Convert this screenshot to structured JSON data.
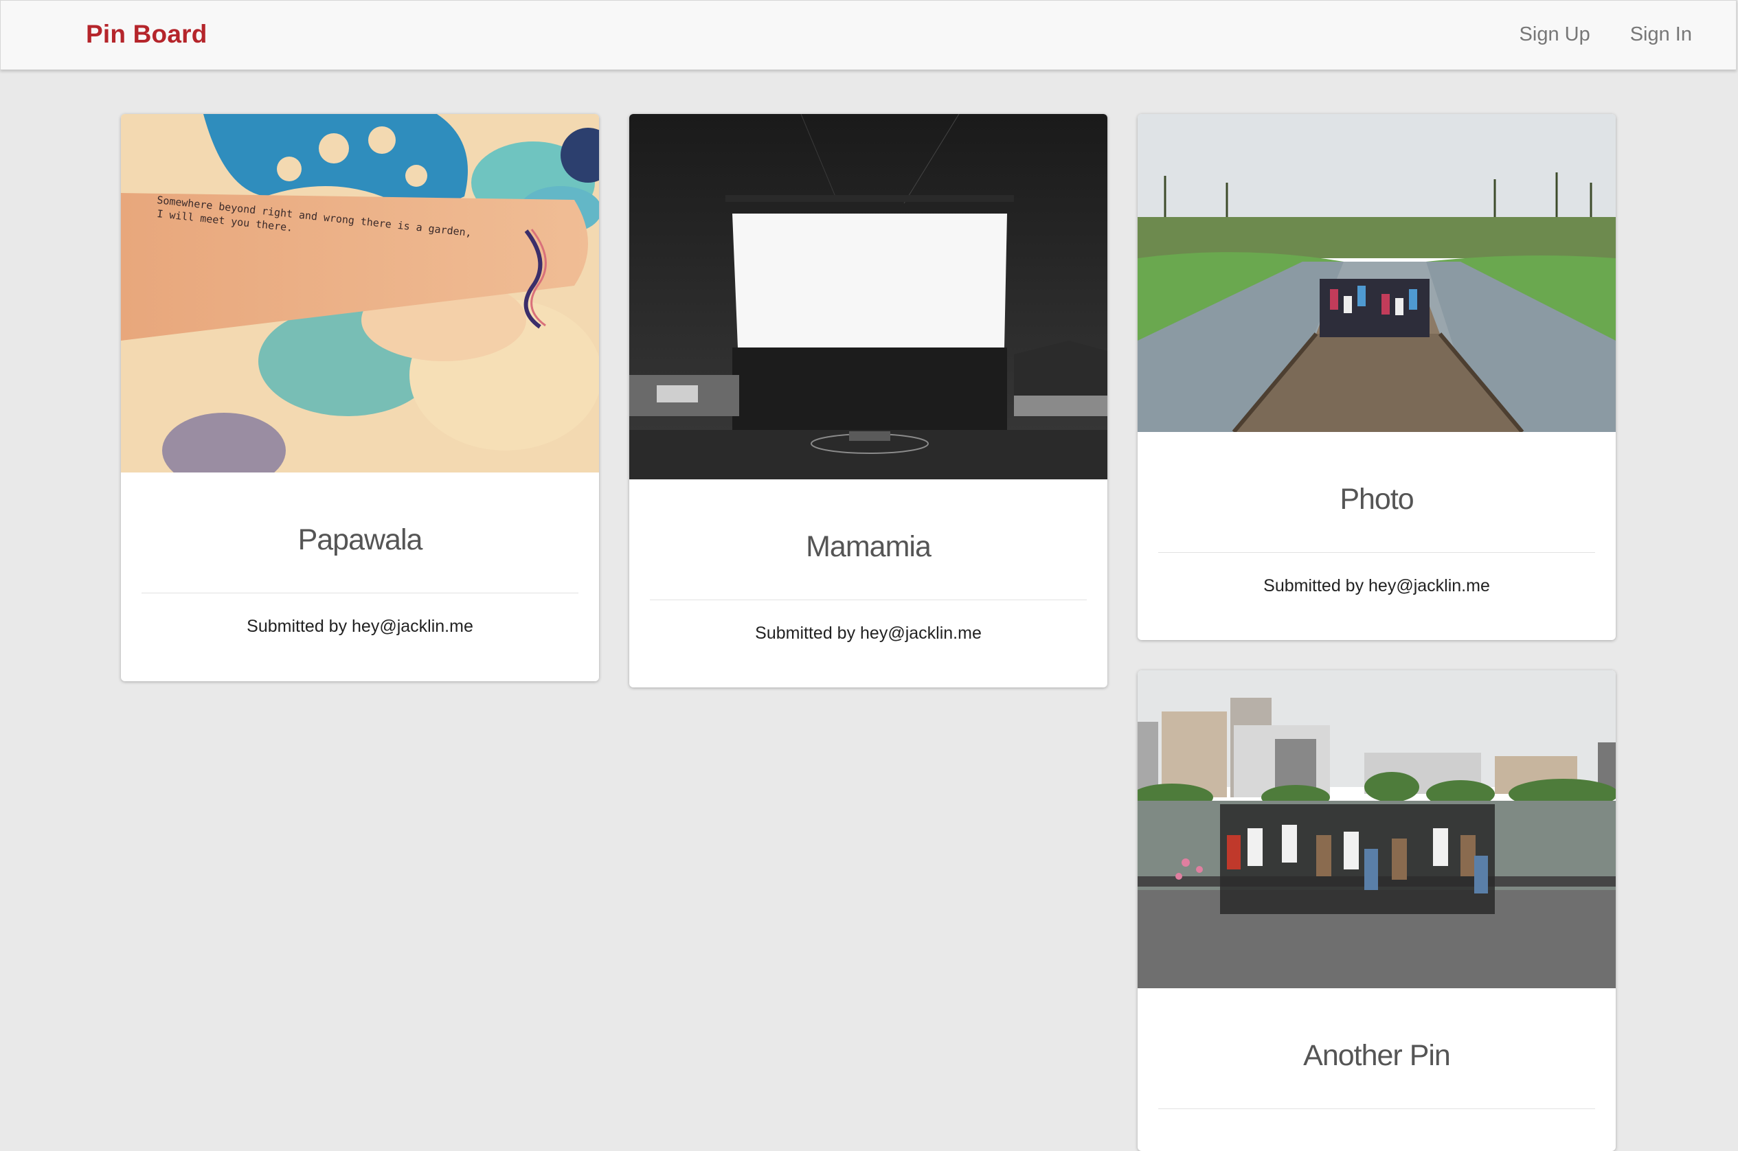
{
  "nav": {
    "brand": "Pin Board",
    "links": [
      "Sign Up",
      "Sign In"
    ]
  },
  "pins": [
    {
      "title": "Papawala",
      "footer": "Submitted by hey@jacklin.me",
      "image_text": [
        "Somewhere beyond right and wrong there is a garden,",
        "I will meet you there."
      ]
    },
    {
      "title": "Mamamia",
      "footer": "Submitted by hey@jacklin.me"
    },
    {
      "title": "Photo",
      "footer": "Submitted by hey@jacklin.me"
    },
    {
      "title": "Another Pin",
      "footer": ""
    }
  ],
  "colors": {
    "brand": "#b5252b",
    "background": "#e9e9e9",
    "navbar": "#f8f8f8"
  }
}
